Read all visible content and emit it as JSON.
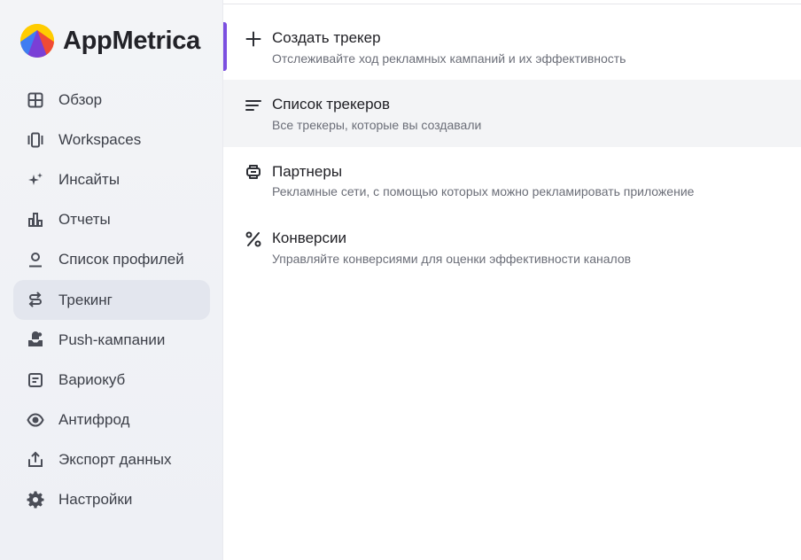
{
  "brand": {
    "name": "AppMetrica",
    "logo_icon": "appmetrica-logo-icon"
  },
  "sidebar": {
    "items": [
      {
        "label": "Обзор",
        "icon": "grid-icon"
      },
      {
        "label": "Workspaces",
        "icon": "workspaces-icon"
      },
      {
        "label": "Инсайты",
        "icon": "sparkles-icon"
      },
      {
        "label": "Отчеты",
        "icon": "bar-chart-icon"
      },
      {
        "label": "Список профилей",
        "icon": "profile-icon"
      },
      {
        "label": "Трекинг",
        "icon": "tracking-icon",
        "active": true
      },
      {
        "label": "Push-кампании",
        "icon": "push-icon"
      },
      {
        "label": "Вариокуб",
        "icon": "variocube-icon"
      },
      {
        "label": "Антифрод",
        "icon": "eye-icon"
      },
      {
        "label": "Экспорт данных",
        "icon": "export-icon"
      },
      {
        "label": "Настройки",
        "icon": "gear-icon"
      }
    ]
  },
  "tracking_menu": {
    "items": [
      {
        "title": "Создать трекер",
        "subtitle": "Отслеживайте ход рекламных кампаний и их эффективность",
        "icon": "plus-icon"
      },
      {
        "title": "Список трекеров",
        "subtitle": "Все трекеры, которые вы создавали",
        "icon": "list-icon"
      },
      {
        "title": "Партнеры",
        "subtitle": "Рекламные сети, с помощью которых можно рекламировать приложение",
        "icon": "partners-icon"
      },
      {
        "title": "Конверсии",
        "subtitle": "Управляйте конверсиями для оценки эффективности каналов",
        "icon": "percent-icon"
      }
    ]
  },
  "colors": {
    "accent": "#7b4fe0",
    "sidebar_bg": "#f3f4f7",
    "active_bg": "#e3e6ee"
  }
}
